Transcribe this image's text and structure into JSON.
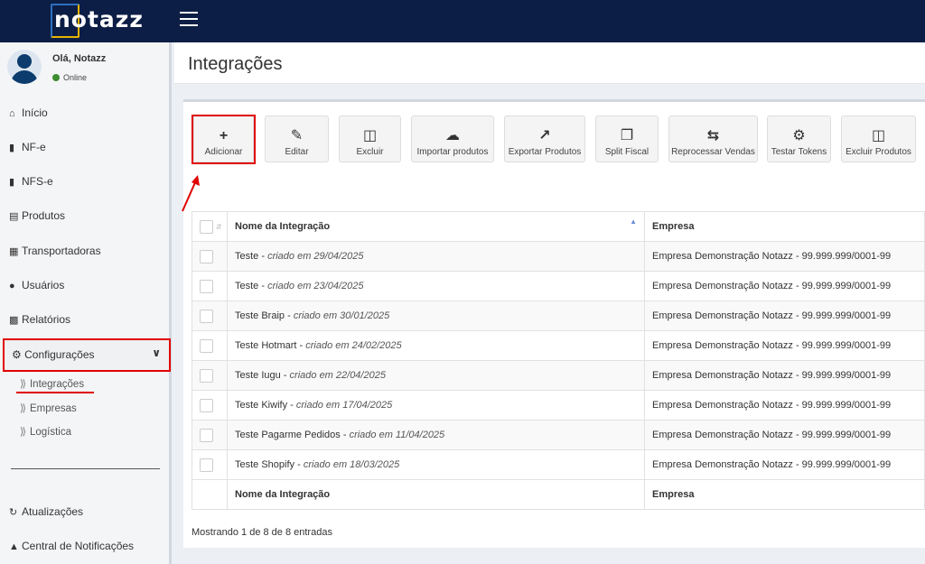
{
  "brand": {
    "logo_text": "notazz"
  },
  "user": {
    "greeting": "Olá, Notazz",
    "status": "Online"
  },
  "sidebar": {
    "items": [
      {
        "label": "Início",
        "icon": "home-icon"
      },
      {
        "label": "NF-e",
        "icon": "file-icon"
      },
      {
        "label": "NFS-e",
        "icon": "file-icon"
      },
      {
        "label": "Produtos",
        "icon": "archive-icon"
      },
      {
        "label": "Transportadoras",
        "icon": "truck-icon"
      },
      {
        "label": "Usuários",
        "icon": "user-icon"
      },
      {
        "label": "Relatórios",
        "icon": "bar-chart-icon"
      }
    ],
    "config": {
      "label": "Configurações",
      "icon": "gear-icon"
    },
    "sub_items": [
      {
        "label": "Integrações"
      },
      {
        "label": "Empresas"
      },
      {
        "label": "Logística"
      }
    ],
    "bottom_items": [
      {
        "label": "Atualizações",
        "icon": "refresh-icon"
      },
      {
        "label": "Central de Notificações",
        "icon": "bell-icon"
      }
    ]
  },
  "page": {
    "title": "Integrações"
  },
  "toolbar": {
    "buttons": [
      {
        "label": "Adicionar",
        "icon": "plus-icon"
      },
      {
        "label": "Editar",
        "icon": "edit-icon"
      },
      {
        "label": "Excluir",
        "icon": "trash-icon"
      },
      {
        "label": "Importar produtos",
        "icon": "cloud-download-icon"
      },
      {
        "label": "Exportar Produtos",
        "icon": "external-link-icon"
      },
      {
        "label": "Split Fiscal",
        "icon": "clone-icon"
      },
      {
        "label": "Reprocessar Vendas",
        "icon": "retweet-icon"
      },
      {
        "label": "Testar Tokens",
        "icon": "cogs-icon"
      },
      {
        "label": "Excluir Produtos",
        "icon": "trash-icon"
      }
    ]
  },
  "table": {
    "headers": {
      "name": "Nome da Integração",
      "company": "Empresa"
    },
    "rows": [
      {
        "name": "Teste",
        "created": "criado em 29/04/2025",
        "company": "Empresa Demonstração Notazz - 99.999.999/0001-99"
      },
      {
        "name": "Teste",
        "created": "criado em 23/04/2025",
        "company": "Empresa Demonstração Notazz - 99.999.999/0001-99"
      },
      {
        "name": "Teste Braip",
        "created": "criado em 30/01/2025",
        "company": "Empresa Demonstração Notazz - 99.999.999/0001-99"
      },
      {
        "name": "Teste Hotmart",
        "created": "criado em 24/02/2025",
        "company": "Empresa Demonstração Notazz - 99.999.999/0001-99"
      },
      {
        "name": "Teste Iugu",
        "created": "criado em 22/04/2025",
        "company": "Empresa Demonstração Notazz - 99.999.999/0001-99"
      },
      {
        "name": "Teste Kiwify",
        "created": "criado em 17/04/2025",
        "company": "Empresa Demonstração Notazz - 99.999.999/0001-99"
      },
      {
        "name": "Teste Pagarme Pedidos",
        "created": "criado em 11/04/2025",
        "company": "Empresa Demonstração Notazz - 99.999.999/0001-99"
      },
      {
        "name": "Teste Shopify",
        "created": "criado em 18/03/2025",
        "company": "Empresa Demonstração Notazz - 99.999.999/0001-99"
      }
    ],
    "info": "Mostrando 1 de 8 de 8 entradas"
  },
  "colors": {
    "topbar": "#0c1e45",
    "highlight": "#e00000",
    "online": "#3c8d2f"
  }
}
